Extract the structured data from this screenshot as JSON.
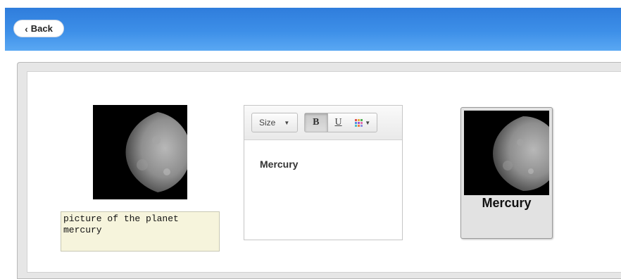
{
  "header": {
    "back_label": "Back"
  },
  "image_editor": {
    "photo_icon": "planet-mercury-photo",
    "caption_value": "picture of the planet\nmercury"
  },
  "text_editor": {
    "size_label": "Size",
    "bold_label": "B",
    "underline_label": "U",
    "content_text": "Mercury"
  },
  "preview_card": {
    "photo_icon": "planet-mercury-photo",
    "label": "Mercury"
  },
  "colors": {
    "header_blue": "#3d8fe8",
    "caption_bg": "#f6f4dc",
    "card_bg": "#e2e2e2"
  }
}
